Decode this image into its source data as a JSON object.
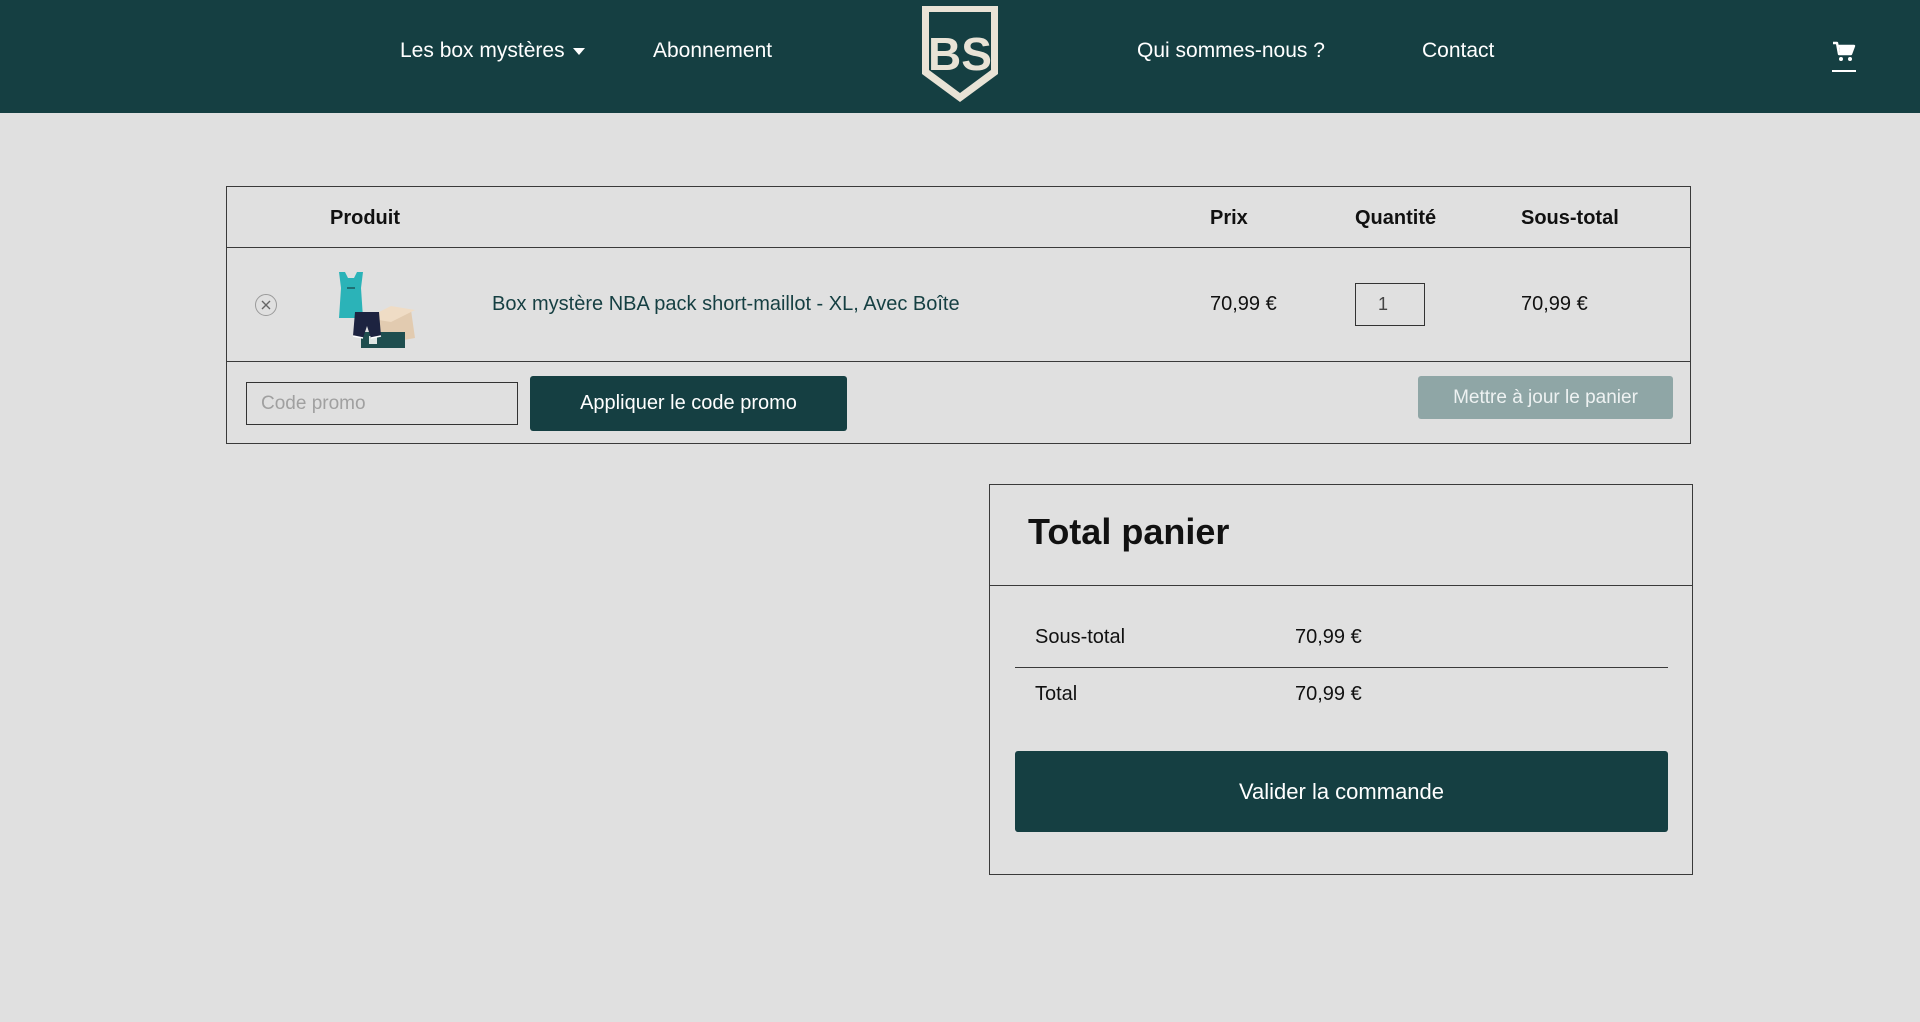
{
  "header": {
    "nav": {
      "boxes_label": "Les box mystères",
      "subscription_label": "Abonnement",
      "about_label": "Qui sommes-nous ?",
      "contact_label": "Contact"
    },
    "logo_text": "BS",
    "cart_icon": "cart-icon"
  },
  "cart": {
    "columns": {
      "product": "Produit",
      "price": "Prix",
      "quantity": "Quantité",
      "subtotal": "Sous-total"
    },
    "items": [
      {
        "name": "Box mystère NBA pack short-maillot - XL, Avec Boîte",
        "price": "70,99 €",
        "quantity": "1",
        "subtotal": "70,99 €",
        "remove_icon": "remove-icon"
      }
    ],
    "coupon": {
      "placeholder": "Code promo",
      "apply_label": "Appliquer le code promo"
    },
    "update_label": "Mettre à jour le panier"
  },
  "totals": {
    "title": "Total panier",
    "subtotal_label": "Sous-total",
    "subtotal_value": "70,99 €",
    "total_label": "Total",
    "total_value": "70,99 €",
    "checkout_label": "Valider la commande"
  },
  "colors": {
    "brand": "#153f42",
    "background": "#e0e0e0",
    "button_disabled": "#8fa6a6"
  }
}
